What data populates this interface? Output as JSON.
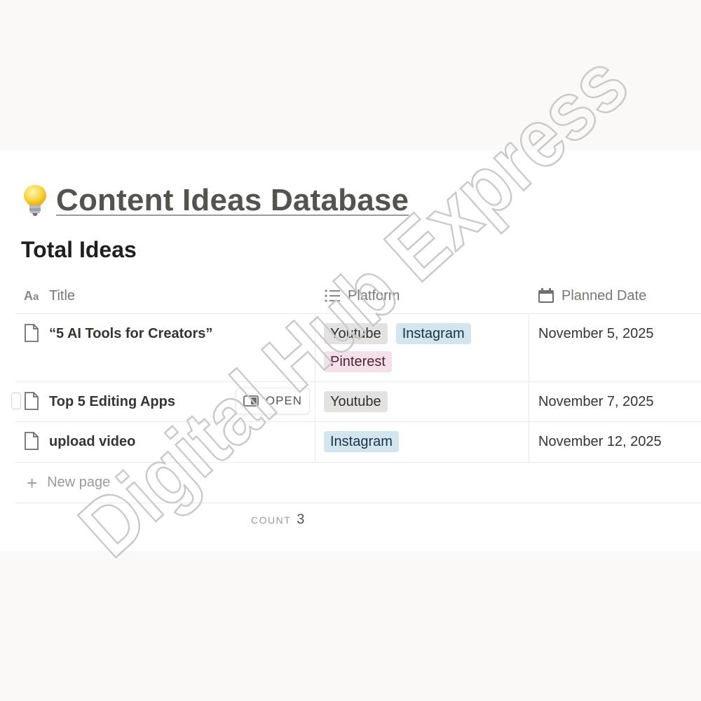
{
  "database": {
    "icon": "lightbulb-icon",
    "title": "Content Ideas Database"
  },
  "view": {
    "title": "Total Ideas"
  },
  "columns": [
    {
      "label": "Title",
      "icon": "aa-text-icon"
    },
    {
      "label": "Platform",
      "icon": "list-icon"
    },
    {
      "label": "Planned Date",
      "icon": "calendar-icon"
    }
  ],
  "rows": [
    {
      "title": "“5 AI Tools for Creators”",
      "platforms": [
        {
          "label": "Youtube",
          "color": "#e3e2e0"
        },
        {
          "label": "Instagram",
          "color": "#d3e5ef"
        },
        {
          "label": "Pinterest",
          "color": "#f5e0e9"
        }
      ],
      "date": "November 5, 2025"
    },
    {
      "title": "Top 5 Editing Apps",
      "platforms": [
        {
          "label": "Youtube",
          "color": "#e3e2e0"
        }
      ],
      "date": "November 7, 2025",
      "open_label": "OPEN"
    },
    {
      "title": "upload video",
      "platforms": [
        {
          "label": "Instagram",
          "color": "#d3e5ef"
        }
      ],
      "date": "November 12, 2025"
    }
  ],
  "new_page_label": "New page",
  "footer": {
    "count_label": "COUNT",
    "count_value": "3"
  },
  "watermark": "Digital Hub Express"
}
